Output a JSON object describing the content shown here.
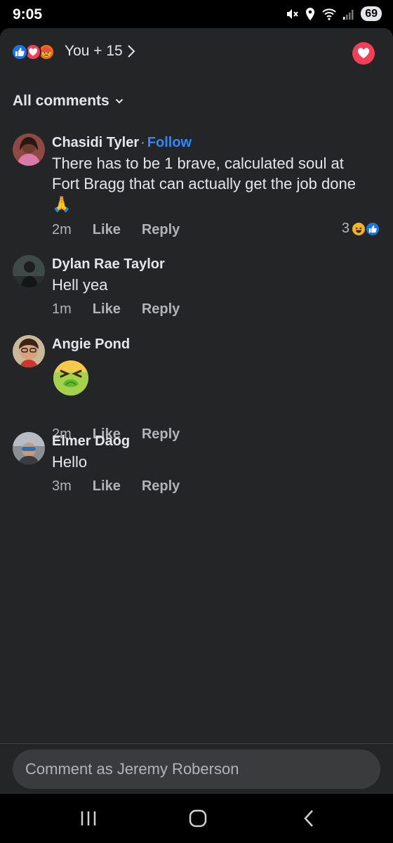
{
  "status_bar": {
    "time": "9:05",
    "battery": "69"
  },
  "header": {
    "reaction_summary": "You + 15",
    "reaction_types": [
      "like",
      "love",
      "angry"
    ]
  },
  "filter": {
    "label": "All comments"
  },
  "comments": [
    {
      "author": "Chasidi Tyler",
      "follow_label": "Follow",
      "text": "There has to be 1 brave, calculated soul at Fort Bragg that can actually get the job done🙏",
      "age": "2m",
      "like_label": "Like",
      "reply_label": "Reply",
      "reaction_count": "3",
      "reactions": [
        "haha",
        "like"
      ]
    },
    {
      "author": "Dylan Rae Taylor",
      "text": "Hell yea",
      "age": "1m",
      "like_label": "Like",
      "reply_label": "Reply"
    },
    {
      "author": "Angie Pond",
      "emoji": "nauseated-face",
      "age": "2m",
      "like_label": "Like",
      "reply_label": "Reply"
    },
    {
      "author": "Elmer Daog",
      "text": "Hello",
      "age": "3m",
      "like_label": "Like",
      "reply_label": "Reply"
    }
  ],
  "composer": {
    "placeholder": "Comment as Jeremy Roberson"
  },
  "colors": {
    "accent": "#2d88ff",
    "like_blue": "#1b74e4",
    "love_red": "#f33e58",
    "background": "#242526"
  }
}
